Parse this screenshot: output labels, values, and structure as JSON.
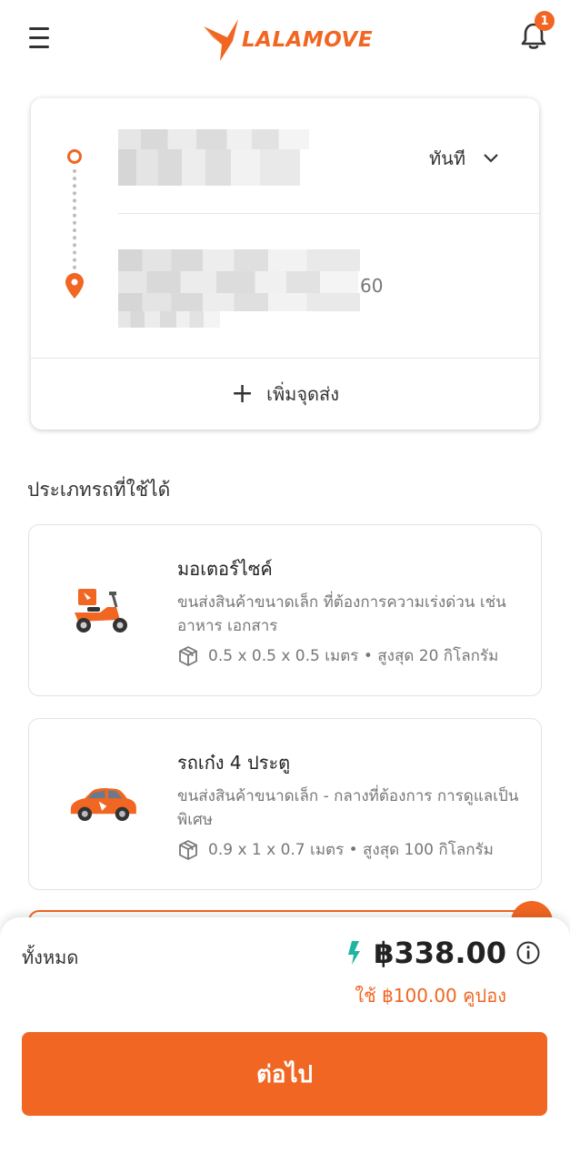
{
  "header": {
    "logo_text": "LALAMOVE",
    "notification_count": "1"
  },
  "route": {
    "pickup_time_label": "ทันที",
    "drop_address_tail": "60",
    "add_stop_label": "เพิ่มจุดส่ง"
  },
  "vehicles": {
    "section_title": "ประเภทรถที่ใช้ได้",
    "items": [
      {
        "name": "มอเตอร์ไซค์",
        "description": "ขนส่งสินค้าขนาดเล็ก ที่ต้องการความเร่งด่วน เช่น อาหาร เอกสาร",
        "spec": "0.5 x 0.5 x 0.5 เมตร • สูงสุด 20 กิโลกรัม",
        "icon": "motorcycle-icon"
      },
      {
        "name": "รถเก๋ง 4 ประตู",
        "description": "ขนส่งสินค้าขนาดเล็ก - กลางที่ต้องการ การดูแลเป็นพิเศษ",
        "spec": "0.9 x 1 x 0.7 เมตร • สูงสุด 100 กิโลกรัม",
        "icon": "sedan-icon"
      }
    ]
  },
  "summary": {
    "total_label": "ทั้งหมด",
    "price": "฿338.00",
    "coupon_text": "ใช้ ฿100.00 คูปอง",
    "next_label": "ต่อไป"
  },
  "colors": {
    "brand": "#f16622",
    "discount_arrow": "#1fb5a0"
  }
}
